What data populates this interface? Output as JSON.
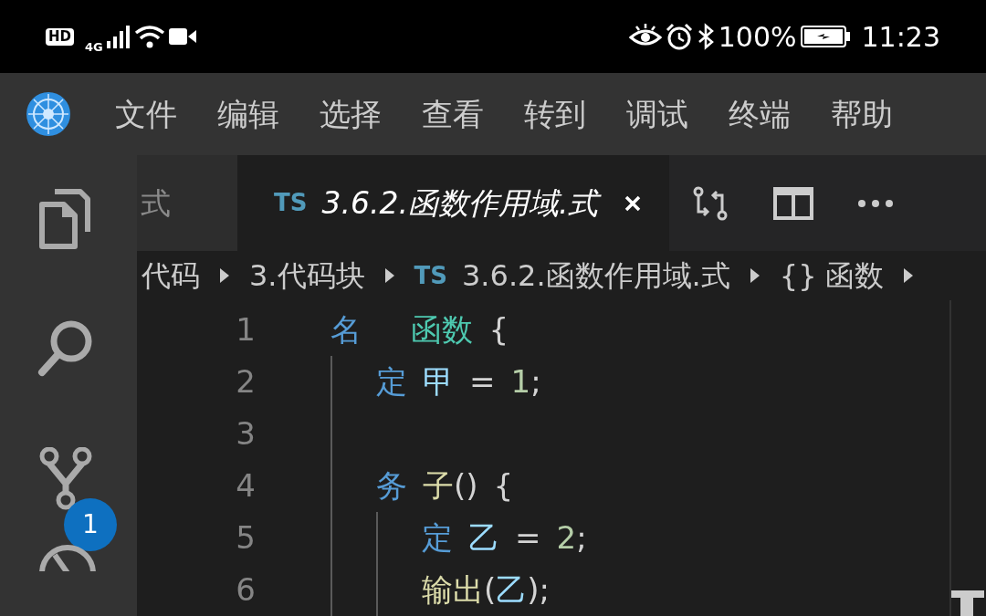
{
  "status_bar": {
    "badges": [
      "HD",
      "4G"
    ],
    "battery": "100%",
    "time": "11:23"
  },
  "menu": {
    "items": [
      "文件",
      "编辑",
      "选择",
      "查看",
      "转到",
      "调试",
      "终端",
      "帮助"
    ]
  },
  "activity_bar": {
    "items": [
      {
        "kind": "files"
      },
      {
        "kind": "search"
      },
      {
        "kind": "source-control",
        "badge": "1"
      },
      {
        "kind": "debug"
      }
    ]
  },
  "tabs": [
    {
      "label": "式",
      "selected": false,
      "preview": false
    },
    {
      "label": "3.6.2.函数作用域.式",
      "selected": true,
      "preview": true,
      "badge": "TS"
    }
  ],
  "breadcrumb": [
    {
      "label": "代码"
    },
    {
      "label": "3.代码块"
    },
    {
      "label": "3.6.2.函数作用域.式",
      "badge": "TS"
    },
    {
      "label": "函数",
      "badge": "{}"
    }
  ],
  "code": {
    "lines": [
      {
        "number": "1",
        "words": [
          [
            {
              "text": "名",
              "kind": "keyword"
            }
          ],
          [
            {
              "text": "函数",
              "kind": "type"
            }
          ],
          [
            {
              "text": "{",
              "kind": "punct"
            }
          ]
        ],
        "children": [
          {
            "number": "2",
            "words": [
              [
                {
                  "text": "定",
                  "kind": "keyword"
                }
              ],
              [
                {
                  "text": "甲",
                  "kind": "variable"
                }
              ],
              [
                {
                  "text": "=",
                  "kind": "punct"
                }
              ],
              [
                {
                  "text": "1",
                  "kind": "number"
                },
                {
                  "text": ";",
                  "kind": "punct"
                }
              ]
            ]
          },
          {
            "number": "3"
          },
          {
            "number": "4",
            "words": [
              [
                {
                  "text": "务",
                  "kind": "keyword"
                }
              ],
              [
                {
                  "text": "子",
                  "kind": "function"
                },
                {
                  "text": "()",
                  "kind": "punct"
                }
              ],
              [
                {
                  "text": "{",
                  "kind": "punct"
                }
              ]
            ],
            "children": [
              {
                "number": "5",
                "words": [
                  [
                    {
                      "text": "定",
                      "kind": "keyword"
                    }
                  ],
                  [
                    {
                      "text": "乙",
                      "kind": "variable"
                    }
                  ],
                  [
                    {
                      "text": "=",
                      "kind": "punct"
                    }
                  ],
                  [
                    {
                      "text": "2",
                      "kind": "number"
                    },
                    {
                      "text": ";",
                      "kind": "punct"
                    }
                  ]
                ]
              },
              {
                "number": "6",
                "words": [
                  [
                    {
                      "text": "输出",
                      "kind": "function"
                    },
                    {
                      "text": "(",
                      "kind": "punct"
                    },
                    {
                      "text": "乙",
                      "kind": "variable"
                    },
                    {
                      "text": ")",
                      "kind": "punct"
                    },
                    {
                      "text": ";",
                      "kind": "punct"
                    }
                  ]
                ]
              }
            ]
          }
        ]
      }
    ]
  }
}
